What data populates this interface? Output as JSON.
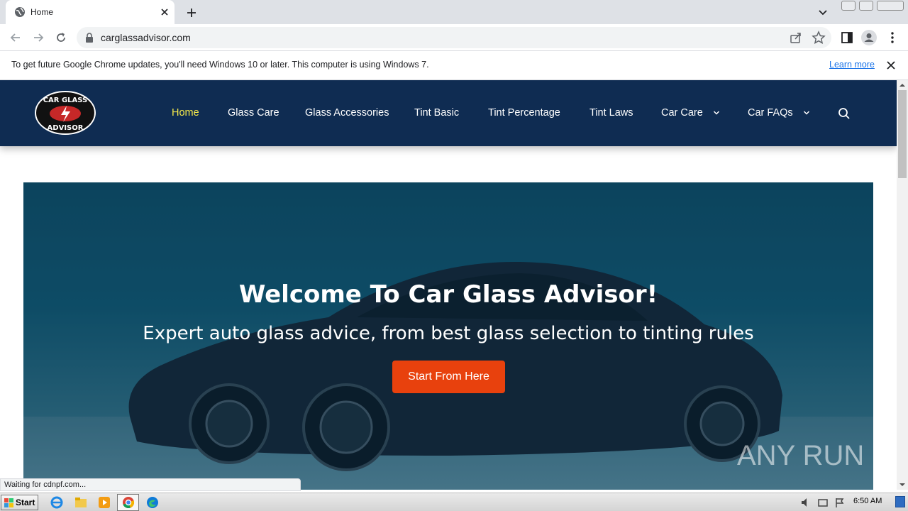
{
  "browser": {
    "tab_title": "Home",
    "url": "carglassadvisor.com",
    "infobar_message": "To get future Google Chrome updates, you'll need Windows 10 or later. This computer is using Windows 7.",
    "infobar_link": "Learn more",
    "status_text": "Waiting for cdnpf.com..."
  },
  "site": {
    "logo_text": [
      "CAR GLASS",
      "ADVISOR"
    ],
    "nav": [
      {
        "label": "Home",
        "active": true
      },
      {
        "label": "Glass Care"
      },
      {
        "label": "Glass Accessories"
      },
      {
        "label": "Tint Basic"
      },
      {
        "label": "Tint Percentage"
      },
      {
        "label": "Tint Laws"
      },
      {
        "label": "Car Care",
        "has_dropdown": true
      },
      {
        "label": "Car FAQs",
        "has_dropdown": true
      }
    ],
    "hero": {
      "title": "Welcome To Car Glass Advisor!",
      "subtitle": "Expert auto glass advice, from best glass selection to tinting rules",
      "button": "Start From Here"
    },
    "watermark": "ANY RUN"
  },
  "taskbar": {
    "start_label": "Start",
    "clock": "6:50 AM"
  },
  "colors": {
    "nav_bg": "#0f2c52",
    "nav_active": "#f5e94b",
    "hero_button": "#e8410d"
  }
}
